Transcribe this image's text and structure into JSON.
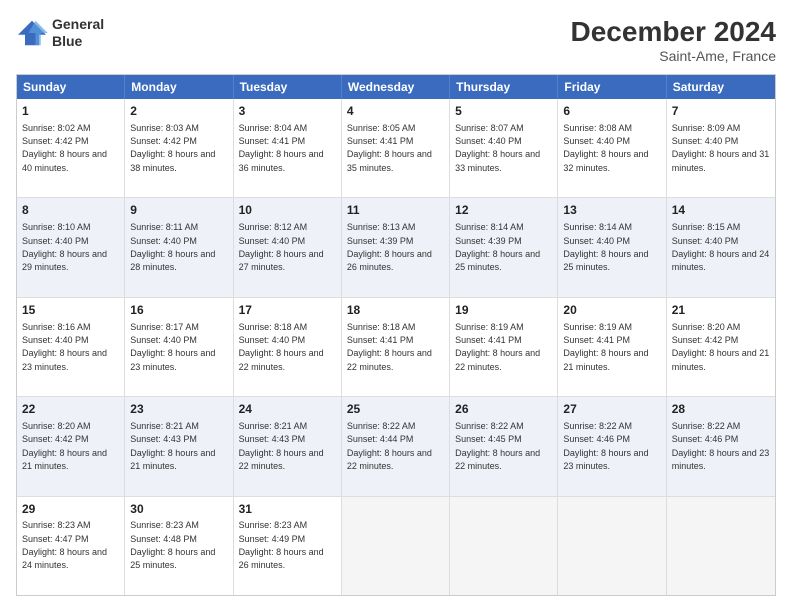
{
  "logo": {
    "line1": "General",
    "line2": "Blue"
  },
  "title": "December 2024",
  "subtitle": "Saint-Ame, France",
  "header_days": [
    "Sunday",
    "Monday",
    "Tuesday",
    "Wednesday",
    "Thursday",
    "Friday",
    "Saturday"
  ],
  "weeks": [
    {
      "alt": false,
      "cells": [
        {
          "day": "1",
          "sunrise": "8:02 AM",
          "sunset": "4:42 PM",
          "daylight": "8 hours and 40 minutes."
        },
        {
          "day": "2",
          "sunrise": "8:03 AM",
          "sunset": "4:42 PM",
          "daylight": "8 hours and 38 minutes."
        },
        {
          "day": "3",
          "sunrise": "8:04 AM",
          "sunset": "4:41 PM",
          "daylight": "8 hours and 36 minutes."
        },
        {
          "day": "4",
          "sunrise": "8:05 AM",
          "sunset": "4:41 PM",
          "daylight": "8 hours and 35 minutes."
        },
        {
          "day": "5",
          "sunrise": "8:07 AM",
          "sunset": "4:40 PM",
          "daylight": "8 hours and 33 minutes."
        },
        {
          "day": "6",
          "sunrise": "8:08 AM",
          "sunset": "4:40 PM",
          "daylight": "8 hours and 32 minutes."
        },
        {
          "day": "7",
          "sunrise": "8:09 AM",
          "sunset": "4:40 PM",
          "daylight": "8 hours and 31 minutes."
        }
      ]
    },
    {
      "alt": true,
      "cells": [
        {
          "day": "8",
          "sunrise": "8:10 AM",
          "sunset": "4:40 PM",
          "daylight": "8 hours and 29 minutes."
        },
        {
          "day": "9",
          "sunrise": "8:11 AM",
          "sunset": "4:40 PM",
          "daylight": "8 hours and 28 minutes."
        },
        {
          "day": "10",
          "sunrise": "8:12 AM",
          "sunset": "4:40 PM",
          "daylight": "8 hours and 27 minutes."
        },
        {
          "day": "11",
          "sunrise": "8:13 AM",
          "sunset": "4:39 PM",
          "daylight": "8 hours and 26 minutes."
        },
        {
          "day": "12",
          "sunrise": "8:14 AM",
          "sunset": "4:39 PM",
          "daylight": "8 hours and 25 minutes."
        },
        {
          "day": "13",
          "sunrise": "8:14 AM",
          "sunset": "4:40 PM",
          "daylight": "8 hours and 25 minutes."
        },
        {
          "day": "14",
          "sunrise": "8:15 AM",
          "sunset": "4:40 PM",
          "daylight": "8 hours and 24 minutes."
        }
      ]
    },
    {
      "alt": false,
      "cells": [
        {
          "day": "15",
          "sunrise": "8:16 AM",
          "sunset": "4:40 PM",
          "daylight": "8 hours and 23 minutes."
        },
        {
          "day": "16",
          "sunrise": "8:17 AM",
          "sunset": "4:40 PM",
          "daylight": "8 hours and 23 minutes."
        },
        {
          "day": "17",
          "sunrise": "8:18 AM",
          "sunset": "4:40 PM",
          "daylight": "8 hours and 22 minutes."
        },
        {
          "day": "18",
          "sunrise": "8:18 AM",
          "sunset": "4:41 PM",
          "daylight": "8 hours and 22 minutes."
        },
        {
          "day": "19",
          "sunrise": "8:19 AM",
          "sunset": "4:41 PM",
          "daylight": "8 hours and 22 minutes."
        },
        {
          "day": "20",
          "sunrise": "8:19 AM",
          "sunset": "4:41 PM",
          "daylight": "8 hours and 21 minutes."
        },
        {
          "day": "21",
          "sunrise": "8:20 AM",
          "sunset": "4:42 PM",
          "daylight": "8 hours and 21 minutes."
        }
      ]
    },
    {
      "alt": true,
      "cells": [
        {
          "day": "22",
          "sunrise": "8:20 AM",
          "sunset": "4:42 PM",
          "daylight": "8 hours and 21 minutes."
        },
        {
          "day": "23",
          "sunrise": "8:21 AM",
          "sunset": "4:43 PM",
          "daylight": "8 hours and 21 minutes."
        },
        {
          "day": "24",
          "sunrise": "8:21 AM",
          "sunset": "4:43 PM",
          "daylight": "8 hours and 22 minutes."
        },
        {
          "day": "25",
          "sunrise": "8:22 AM",
          "sunset": "4:44 PM",
          "daylight": "8 hours and 22 minutes."
        },
        {
          "day": "26",
          "sunrise": "8:22 AM",
          "sunset": "4:45 PM",
          "daylight": "8 hours and 22 minutes."
        },
        {
          "day": "27",
          "sunrise": "8:22 AM",
          "sunset": "4:46 PM",
          "daylight": "8 hours and 23 minutes."
        },
        {
          "day": "28",
          "sunrise": "8:22 AM",
          "sunset": "4:46 PM",
          "daylight": "8 hours and 23 minutes."
        }
      ]
    },
    {
      "alt": false,
      "cells": [
        {
          "day": "29",
          "sunrise": "8:23 AM",
          "sunset": "4:47 PM",
          "daylight": "8 hours and 24 minutes."
        },
        {
          "day": "30",
          "sunrise": "8:23 AM",
          "sunset": "4:48 PM",
          "daylight": "8 hours and 25 minutes."
        },
        {
          "day": "31",
          "sunrise": "8:23 AM",
          "sunset": "4:49 PM",
          "daylight": "8 hours and 26 minutes."
        },
        {
          "day": "",
          "sunrise": "",
          "sunset": "",
          "daylight": ""
        },
        {
          "day": "",
          "sunrise": "",
          "sunset": "",
          "daylight": ""
        },
        {
          "day": "",
          "sunrise": "",
          "sunset": "",
          "daylight": ""
        },
        {
          "day": "",
          "sunrise": "",
          "sunset": "",
          "daylight": ""
        }
      ]
    }
  ],
  "labels": {
    "sunrise": "Sunrise: ",
    "sunset": "Sunset: ",
    "daylight": "Daylight: "
  }
}
